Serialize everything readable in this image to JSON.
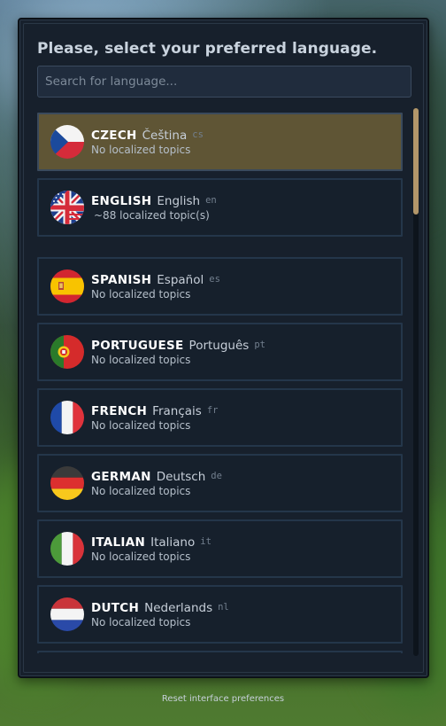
{
  "dialog": {
    "title": "Please, select your preferred language.",
    "search_placeholder": "Search for language...",
    "reset_label": "Reset interface preferences"
  },
  "languages": [
    {
      "name": "CZECH",
      "native": "Čeština",
      "code": "cs",
      "topics": "No localized topics",
      "flag": "czech-flag-icon",
      "selected": true
    },
    {
      "name": "ENGLISH",
      "native": "English",
      "code": "en",
      "topics": "~88 localized topic(s)",
      "flag": "uk-us-flag-icon",
      "selected": false
    },
    {
      "name": "SPANISH",
      "native": "Español",
      "code": "es",
      "topics": "No localized topics",
      "flag": "spain-flag-icon",
      "selected": false
    },
    {
      "name": "PORTUGUESE",
      "native": "Português",
      "code": "pt",
      "topics": "No localized topics",
      "flag": "portugal-flag-icon",
      "selected": false
    },
    {
      "name": "FRENCH",
      "native": "Français",
      "code": "fr",
      "topics": "No localized topics",
      "flag": "france-flag-icon",
      "selected": false
    },
    {
      "name": "GERMAN",
      "native": "Deutsch",
      "code": "de",
      "topics": "No localized topics",
      "flag": "germany-flag-icon",
      "selected": false
    },
    {
      "name": "ITALIAN",
      "native": "Italiano",
      "code": "it",
      "topics": "No localized topics",
      "flag": "italy-flag-icon",
      "selected": false
    },
    {
      "name": "DUTCH",
      "native": "Nederlands",
      "code": "nl",
      "topics": "No localized topics",
      "flag": "netherlands-flag-icon",
      "selected": false
    }
  ],
  "colors": {
    "panel_bg": "#17202c",
    "selected_bg": "#5f5535",
    "scroll_thumb": "#b2966a",
    "border": "#24364a"
  }
}
